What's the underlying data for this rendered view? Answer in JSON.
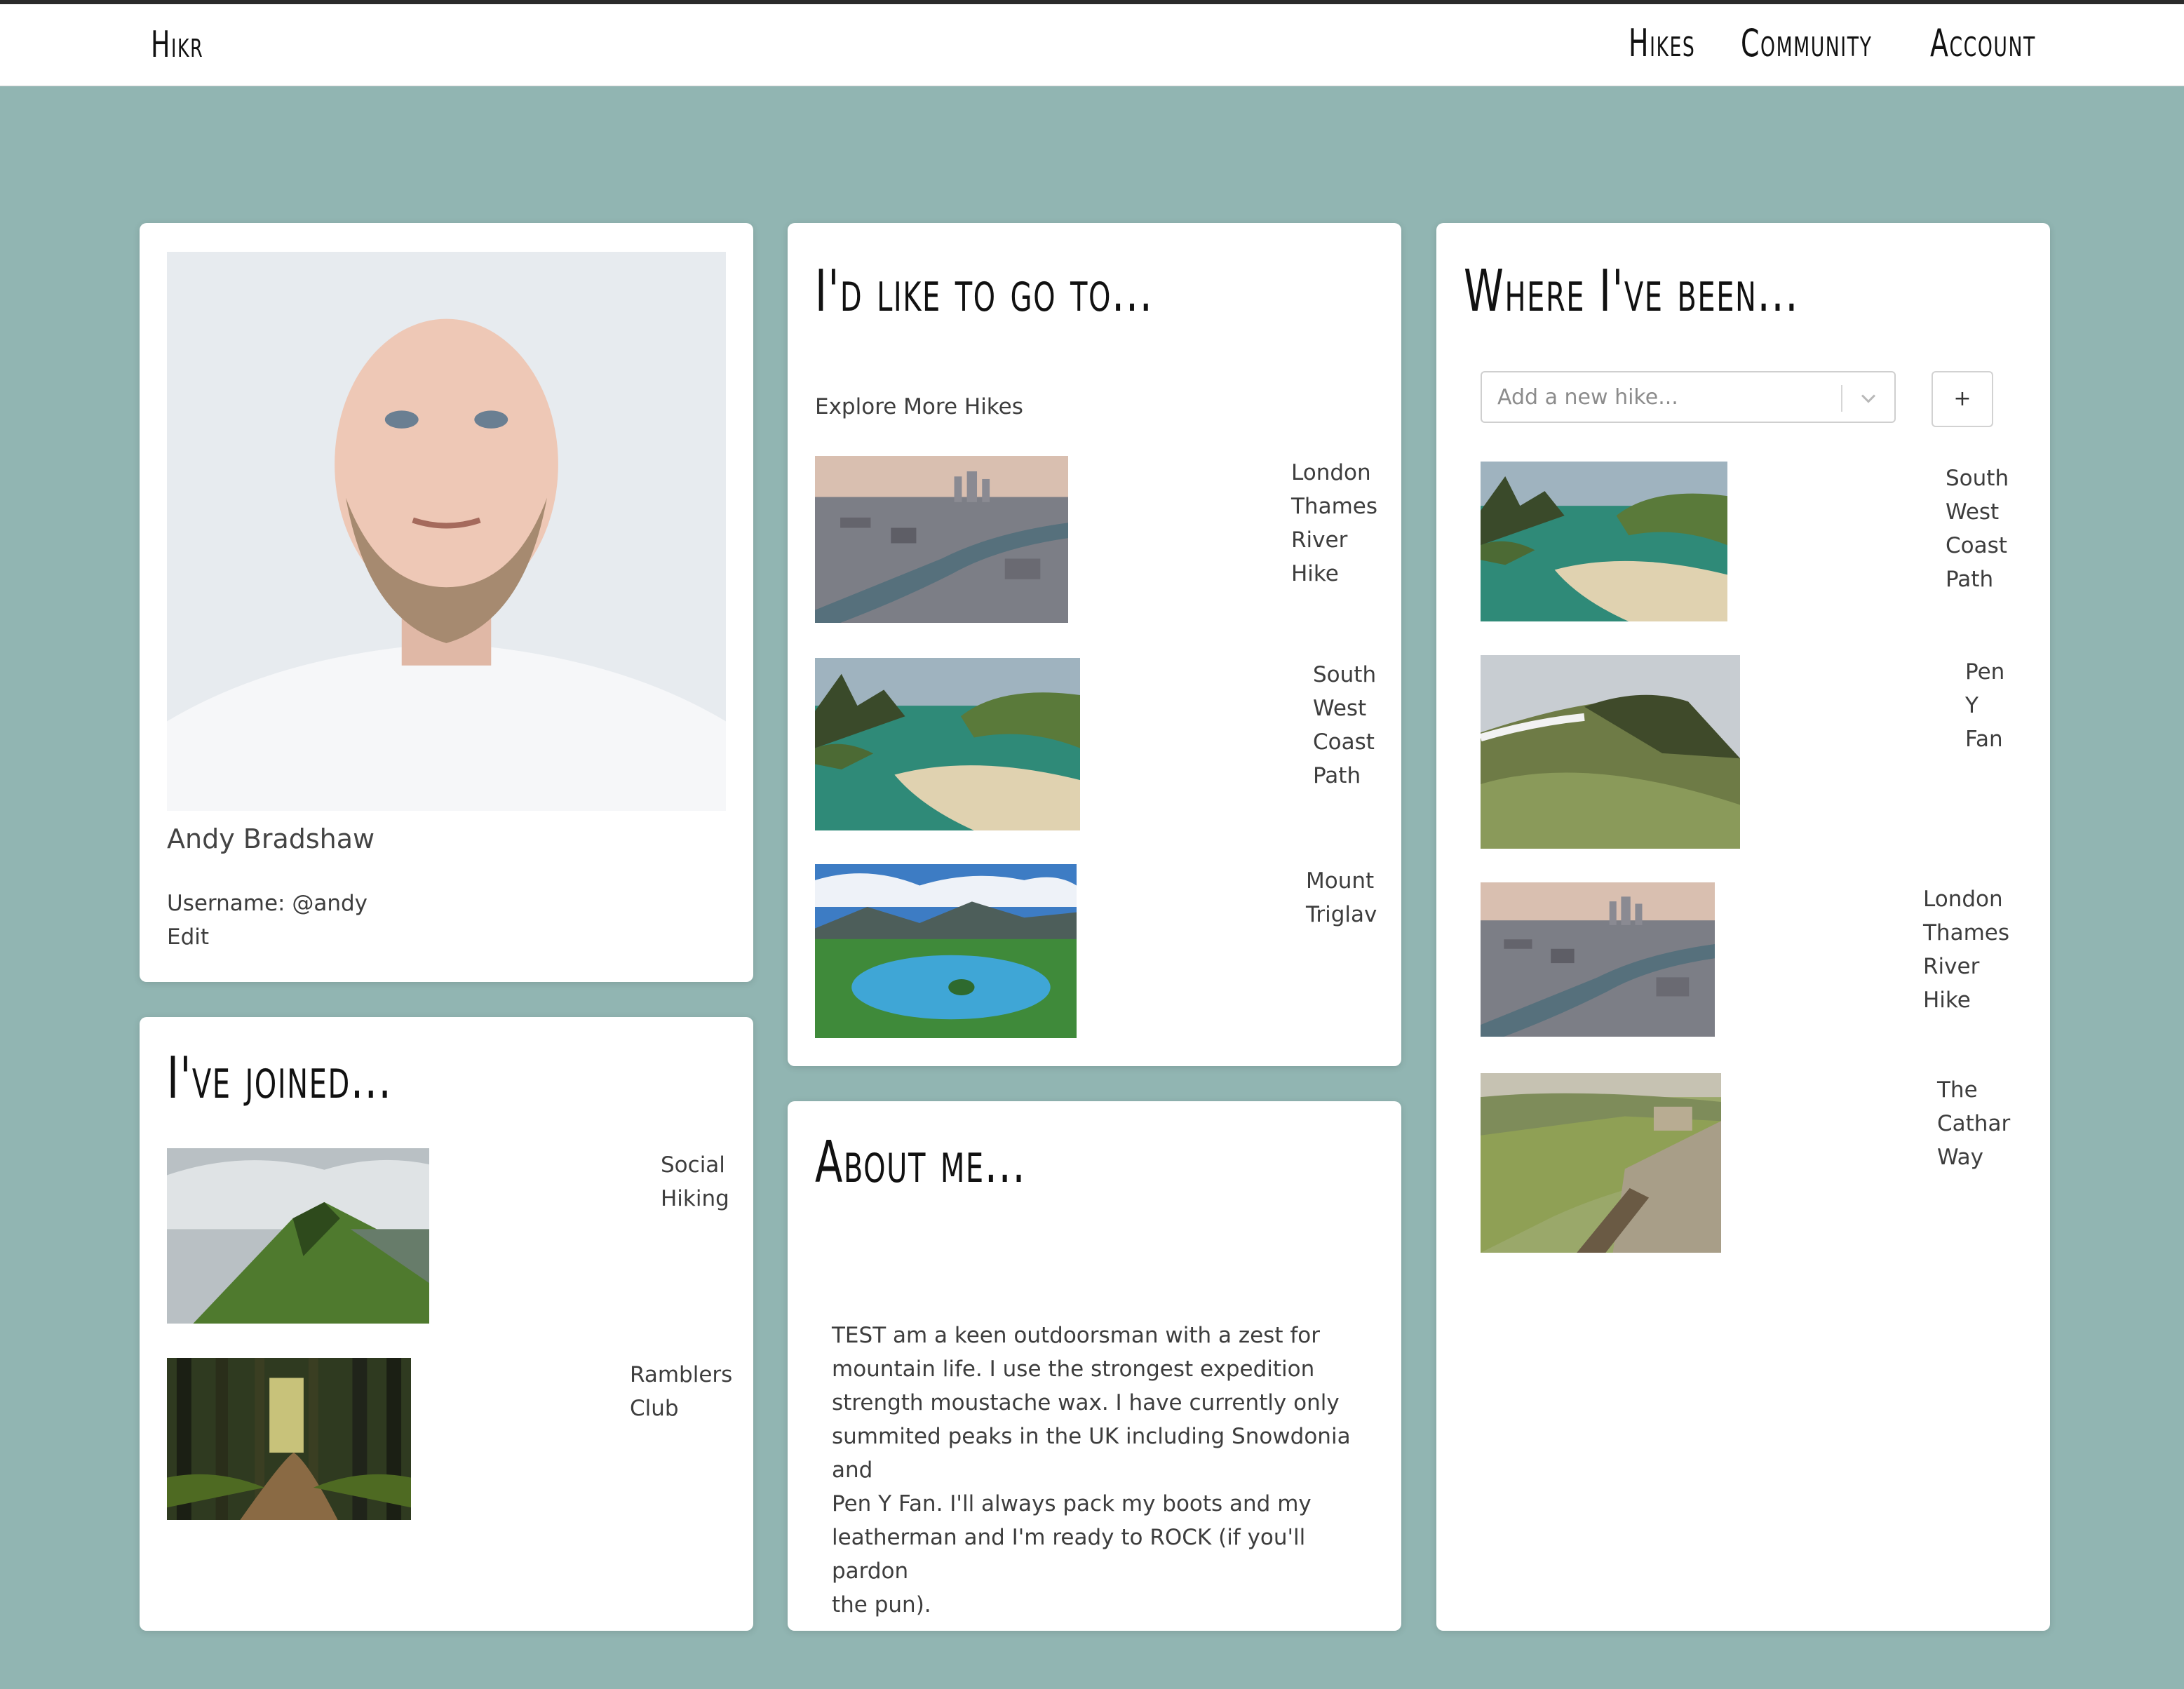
{
  "nav": {
    "brand": "Hikr",
    "links": [
      "Hikes",
      "Community",
      "Account"
    ]
  },
  "profile": {
    "name": "Andy Bradshaw",
    "username": "Username: @andy",
    "edit": "Edit"
  },
  "joined": {
    "title": "I've joined...",
    "groups": [
      {
        "name_lines": [
          "Social",
          "Hiking"
        ]
      },
      {
        "name_lines": [
          "Ramblers",
          "Club"
        ]
      }
    ]
  },
  "wishlist": {
    "title": "I'd like to go to...",
    "explore_link": "Explore More Hikes",
    "hikes": [
      {
        "name_lines": [
          "London",
          "Thames",
          "River",
          "Hike"
        ]
      },
      {
        "name_lines": [
          "South",
          "West",
          "Coast",
          "Path"
        ]
      },
      {
        "name_lines": [
          "Mount",
          "Triglav"
        ]
      }
    ]
  },
  "about": {
    "title": "About me...",
    "text_lines": [
      "TEST am a keen outdoorsman with a zest for",
      "mountain life. I use the strongest expedition",
      "strength moustache wax. I have currently only",
      "summited peaks in the UK including Snowdonia and",
      "Pen Y Fan. I'll always pack my boots and my",
      "leatherman and I'm ready to ROCK (if you'll pardon",
      "the pun)."
    ]
  },
  "been": {
    "title": "Where I've been...",
    "add_placeholder": "Add a new hike...",
    "add_button": "+",
    "hikes": [
      {
        "name_lines": [
          "South",
          "West",
          "Coast",
          "Path"
        ]
      },
      {
        "name_lines": [
          "Pen",
          "Y",
          "Fan"
        ]
      },
      {
        "name_lines": [
          "London",
          "Thames",
          "River",
          "Hike"
        ]
      },
      {
        "name_lines": [
          "The",
          "Cathar",
          "Way"
        ]
      }
    ]
  },
  "colors": {
    "page_background": "#91b5b2",
    "card_background": "#ffffff"
  }
}
